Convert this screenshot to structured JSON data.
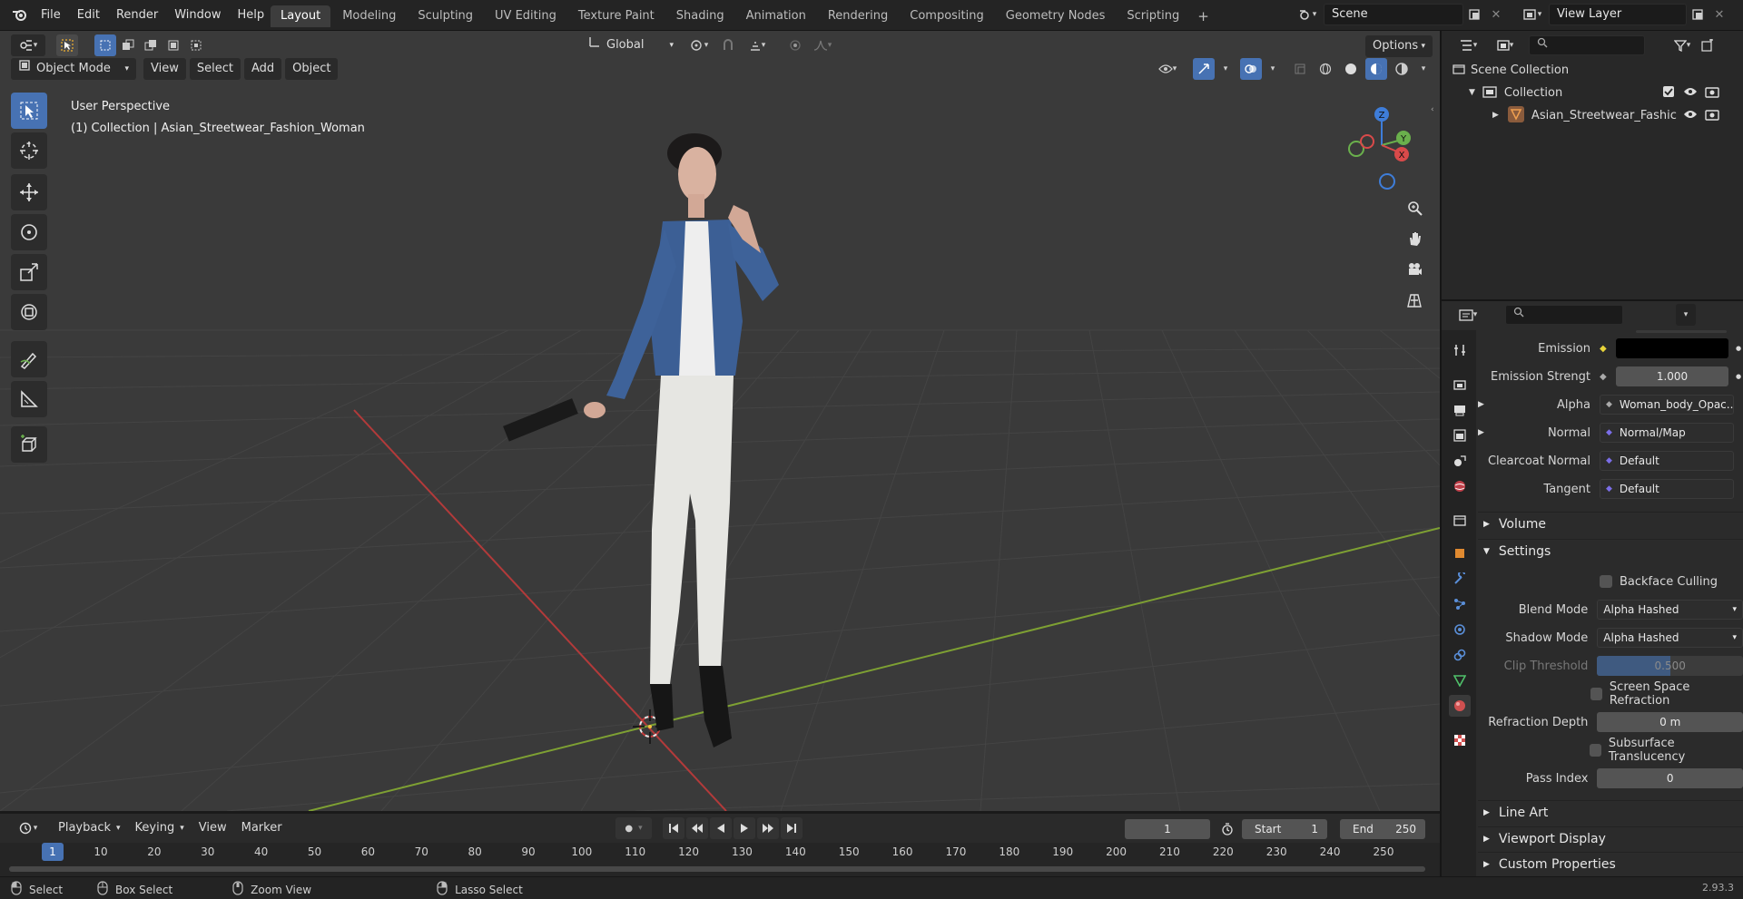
{
  "topbar": {
    "menus": [
      "File",
      "Edit",
      "Render",
      "Window",
      "Help"
    ],
    "workspaces": [
      "Layout",
      "Modeling",
      "Sculpting",
      "UV Editing",
      "Texture Paint",
      "Shading",
      "Animation",
      "Rendering",
      "Compositing",
      "Geometry Nodes",
      "Scripting"
    ],
    "active_workspace": "Layout",
    "add_tab": "+",
    "scene": "Scene",
    "view_layer": "View Layer"
  },
  "viewport": {
    "mode": "Object Mode",
    "menus": [
      "View",
      "Select",
      "Add",
      "Object"
    ],
    "transform_orientation": "Global",
    "options": "Options",
    "overlay_line1": "User Perspective",
    "overlay_line2": "(1) Collection | Asian_Streetwear_Fashion_Woman",
    "gizmo": {
      "z": "Z",
      "y": "Y",
      "x": "X"
    },
    "background_color": "#3a3a3a",
    "x_axis_color": "#b33a3a",
    "y_axis_color": "#7ea033"
  },
  "outliner": {
    "root": "Scene Collection",
    "collection": "Collection",
    "object": "Asian_Streetwear_Fashic"
  },
  "properties": {
    "emission_label": "Emission",
    "emission_color": "#000000",
    "emission_strength_label": "Emission Strengt",
    "emission_strength_value": "1.000",
    "alpha_label": "Alpha",
    "alpha_value": "Woman_body_Opac...",
    "normal_label": "Normal",
    "normal_value": "Normal/Map",
    "clearcoat_label": "Clearcoat Normal",
    "clearcoat_value": "Default",
    "tangent_label": "Tangent",
    "tangent_value": "Default",
    "volume": "Volume",
    "settings": "Settings",
    "backface": "Backface Culling",
    "blend_mode_label": "Blend Mode",
    "blend_mode_value": "Alpha Hashed",
    "shadow_mode_label": "Shadow Mode",
    "shadow_mode_value": "Alpha Hashed",
    "clip_label": "Clip Threshold",
    "clip_value": "0.500",
    "ssr": "Screen Space Refraction",
    "refraction_depth_label": "Refraction Depth",
    "refraction_depth_value": "0 m",
    "subsurface": "Subsurface Translucency",
    "pass_index_label": "Pass Index",
    "pass_index_value": "0",
    "line_art": "Line Art",
    "viewport_display": "Viewport Display",
    "custom_properties": "Custom Properties"
  },
  "timeline": {
    "menus": [
      "Playback",
      "Keying",
      "View",
      "Marker"
    ],
    "current_frame": "1",
    "start_label": "Start",
    "start_value": "1",
    "end_label": "End",
    "end_value": "250",
    "ticks": [
      "1",
      "10",
      "20",
      "30",
      "40",
      "50",
      "60",
      "70",
      "80",
      "90",
      "100",
      "110",
      "120",
      "130",
      "140",
      "150",
      "160",
      "170",
      "180",
      "190",
      "200",
      "210",
      "220",
      "230",
      "240",
      "250"
    ]
  },
  "statusbar": {
    "select": "Select",
    "box_select": "Box Select",
    "zoom_view": "Zoom View",
    "lasso_select": "Lasso Select",
    "version": "2.93.3"
  }
}
